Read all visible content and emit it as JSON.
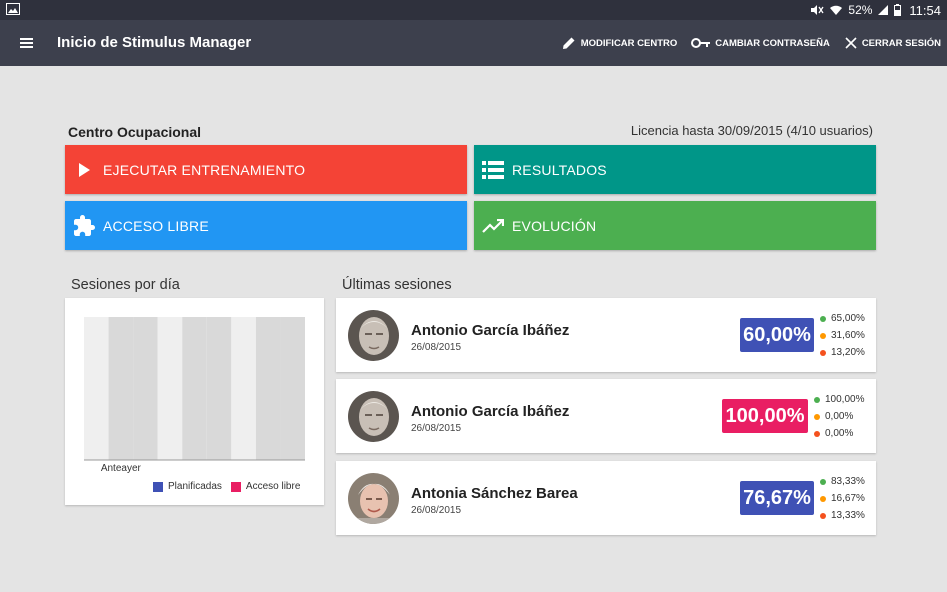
{
  "status_bar": {
    "battery": "52%",
    "time": "11:54"
  },
  "app_bar": {
    "title": "Inicio de Stimulus Manager",
    "actions": [
      {
        "label": "MODIFICAR CENTRO",
        "icon": "pencil-icon"
      },
      {
        "label": "CAMBIAR CONTRASEÑA",
        "icon": "key-icon"
      },
      {
        "label": "CERRAR SESIÓN",
        "icon": "close-icon"
      }
    ]
  },
  "center": {
    "name": "Centro Ocupacional",
    "license": "Licencia hasta 30/09/2015 (4/10 usuarios)"
  },
  "tiles": [
    {
      "label": "EJECUTAR ENTRENAMIENTO",
      "icon": "play-icon",
      "color": "#f44336"
    },
    {
      "label": "RESULTADOS",
      "icon": "list-icon",
      "color": "#009688"
    },
    {
      "label": "ACCESO LIBRE",
      "icon": "puzzle-icon",
      "color": "#2196f3"
    },
    {
      "label": "EVOLUCIÓN",
      "icon": "trending-up-icon",
      "color": "#4caf50"
    }
  ],
  "sessions_chart": {
    "title": "Sesiones por día",
    "legend": [
      {
        "label": "Planificadas",
        "color": "#3f51b5"
      },
      {
        "label": "Acceso libre",
        "color": "#e91e63"
      }
    ]
  },
  "chart_data": {
    "type": "bar",
    "categories": [
      "Anteayer"
    ],
    "series": [
      {
        "name": "Planificadas",
        "values": [
          0
        ]
      },
      {
        "name": "Acceso libre",
        "values": [
          0
        ]
      }
    ],
    "xlabel": "",
    "ylabel": "",
    "grid": true,
    "legend": "bottom"
  },
  "recent_sessions": {
    "title": "Últimas sesiones",
    "items": [
      {
        "name": "Antonio García Ibáñez",
        "date": "26/08/2015",
        "score": "60,00%",
        "score_color": "#3f51b5",
        "stats": [
          {
            "value": "65,00%",
            "color": "#4caf50"
          },
          {
            "value": "31,60%",
            "color": "#ff9800"
          },
          {
            "value": "13,20%",
            "color": "#f4511e"
          }
        ]
      },
      {
        "name": "Antonio García Ibáñez",
        "date": "26/08/2015",
        "score": "100,00%",
        "score_color": "#e91e63",
        "stats": [
          {
            "value": "100,00%",
            "color": "#4caf50"
          },
          {
            "value": "0,00%",
            "color": "#ff9800"
          },
          {
            "value": "0,00%",
            "color": "#f4511e"
          }
        ]
      },
      {
        "name": "Antonia Sánchez Barea",
        "date": "26/08/2015",
        "score": "76,67%",
        "score_color": "#3f51b5",
        "stats": [
          {
            "value": "83,33%",
            "color": "#4caf50"
          },
          {
            "value": "16,67%",
            "color": "#ff9800"
          },
          {
            "value": "13,33%",
            "color": "#f4511e"
          }
        ]
      }
    ]
  }
}
